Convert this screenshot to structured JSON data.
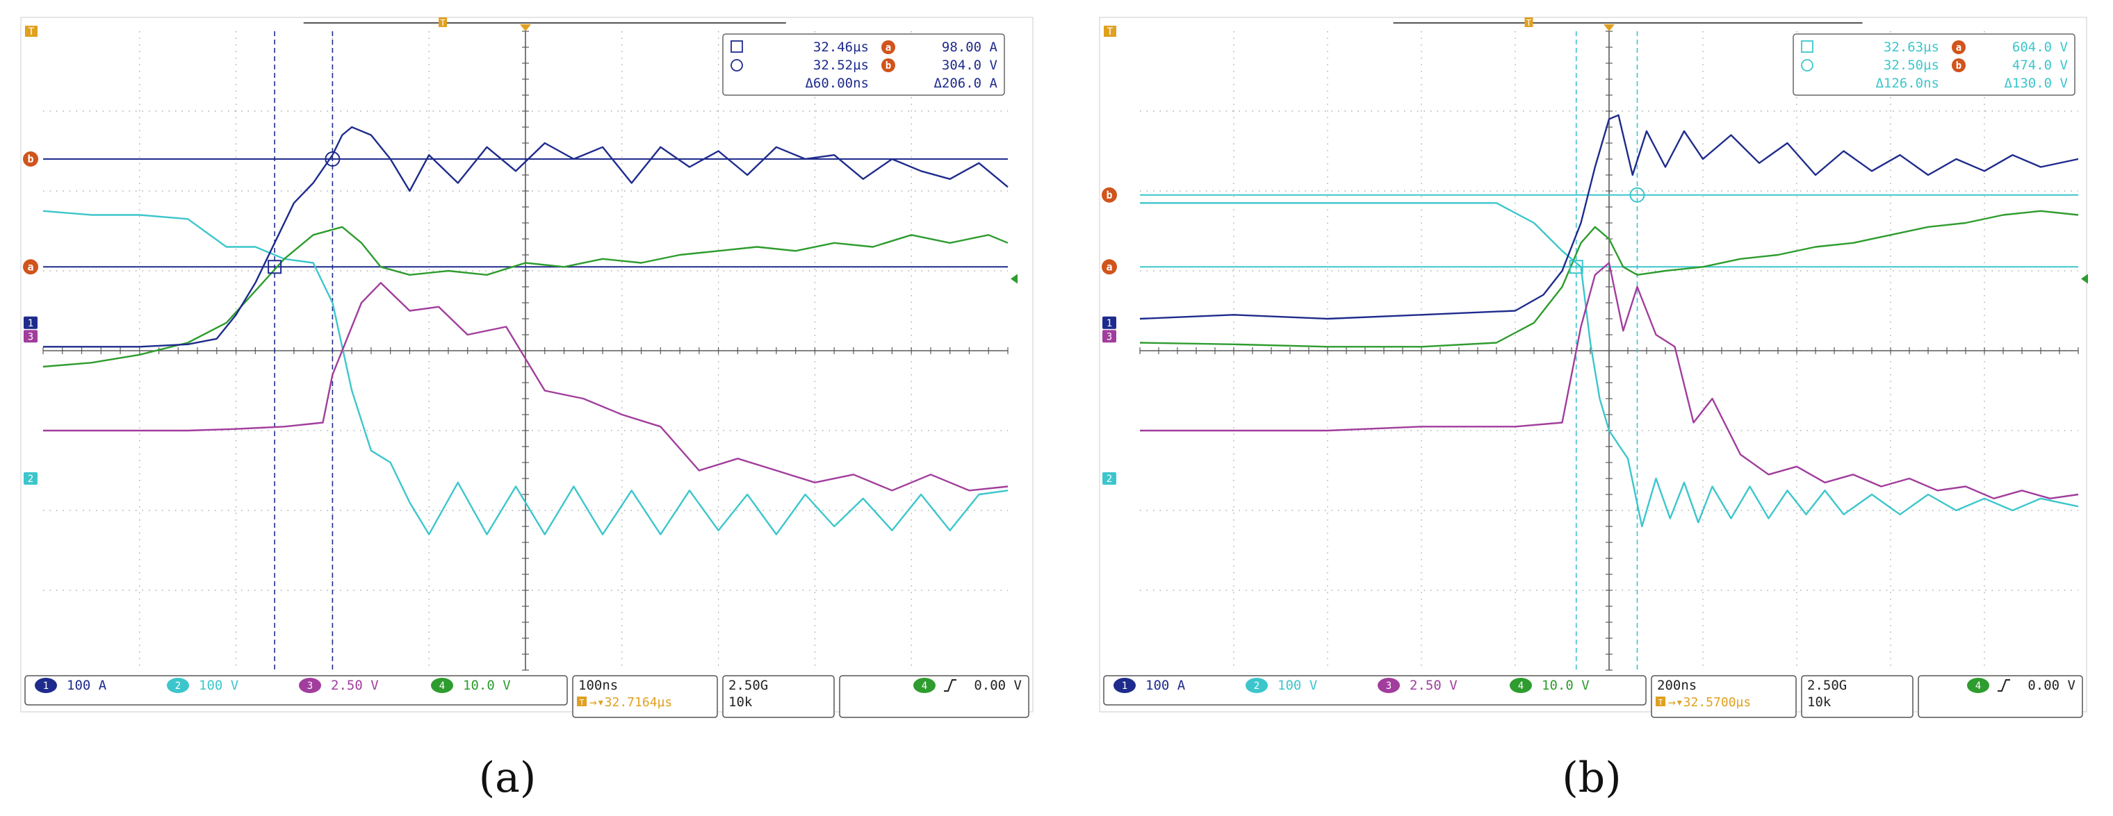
{
  "colors": {
    "ch1": "#1e2b8c",
    "ch2": "#3cc6cc",
    "ch3": "#a13d9c",
    "ch4": "#2e9c2e",
    "cursor_ab": "#d0541c",
    "trigger": "#e0a020",
    "grid": "#9a9a9a",
    "axis": "#5a5a5a",
    "frame": "#555555"
  },
  "chart_data": [
    {
      "type": "line",
      "sublabel": "(a)",
      "markers": {
        "trigger": "T",
        "cursor_a": "a",
        "cursor_b": "b",
        "ch1": "1",
        "ch2": "2",
        "ch3": "3",
        "ch4": "4"
      },
      "grid": {
        "divisions_x": 10,
        "divisions_y": 8
      },
      "readout": {
        "t1": "32.46µs",
        "t2": "32.52µs",
        "dt": "Δ60.00ns",
        "a_value": "98.00 A",
        "b_value": "304.0 V",
        "d_value": "Δ206.0 A"
      },
      "bottom_bar": {
        "ch1_scale": "100 A",
        "ch2_scale": "100 V",
        "ch3_scale": "2.50 V",
        "ch4_scale": "10.0 V",
        "timebase": "100ns",
        "trigger_pos": "32.7164µs",
        "sample_rate": "2.50G",
        "record_length": "10k",
        "trigger_source": "4",
        "trigger_level": "0.00 V"
      },
      "x_range_div": [
        0,
        10
      ],
      "y_range_div": [
        -4,
        4
      ],
      "ch1_level_div": 0.35,
      "ch2_level_div": -1.6,
      "ch3_level_div": 0.18,
      "cursor_time_div": [
        2.4,
        3.0
      ],
      "cursor_level_div": [
        1.05,
        2.4
      ],
      "series": [
        {
          "name": "1",
          "x": [
            0,
            0.5,
            1,
            1.5,
            1.8,
            2.0,
            2.2,
            2.4,
            2.6,
            2.8,
            3.0,
            3.1,
            3.2,
            3.4,
            3.6,
            3.8,
            4.0,
            4.3,
            4.6,
            4.9,
            5.2,
            5.5,
            5.8,
            6.1,
            6.4,
            6.7,
            7.0,
            7.3,
            7.6,
            7.9,
            8.2,
            8.5,
            8.8,
            9.1,
            9.4,
            9.7,
            10
          ],
          "y": [
            0.05,
            0.05,
            0.05,
            0.08,
            0.15,
            0.45,
            0.85,
            1.35,
            1.85,
            2.1,
            2.45,
            2.7,
            2.8,
            2.7,
            2.4,
            2.0,
            2.45,
            2.1,
            2.55,
            2.25,
            2.6,
            2.4,
            2.55,
            2.1,
            2.55,
            2.3,
            2.5,
            2.2,
            2.55,
            2.4,
            2.45,
            2.15,
            2.4,
            2.25,
            2.15,
            2.35,
            2.05
          ]
        },
        {
          "name": "2",
          "x": [
            0,
            0.5,
            1,
            1.5,
            1.9,
            2.2,
            2.5,
            2.8,
            3.0,
            3.2,
            3.4,
            3.6,
            3.8,
            4.0,
            4.3,
            4.6,
            4.9,
            5.2,
            5.5,
            5.8,
            6.1,
            6.4,
            6.7,
            7.0,
            7.3,
            7.6,
            7.9,
            8.2,
            8.5,
            8.8,
            9.1,
            9.4,
            9.7,
            10
          ],
          "y": [
            1.75,
            1.7,
            1.7,
            1.65,
            1.3,
            1.3,
            1.15,
            1.1,
            0.6,
            -0.5,
            -1.25,
            -1.4,
            -1.9,
            -2.3,
            -1.65,
            -2.3,
            -1.7,
            -2.3,
            -1.7,
            -2.3,
            -1.75,
            -2.3,
            -1.75,
            -2.25,
            -1.8,
            -2.3,
            -1.8,
            -2.2,
            -1.85,
            -2.25,
            -1.8,
            -2.25,
            -1.8,
            -1.75
          ]
        },
        {
          "name": "3",
          "x": [
            0,
            0.5,
            1,
            1.5,
            2.0,
            2.5,
            2.9,
            3.0,
            3.1,
            3.3,
            3.5,
            3.8,
            4.1,
            4.4,
            4.8,
            5.2,
            5.6,
            6.0,
            6.4,
            6.8,
            7.2,
            7.6,
            8.0,
            8.4,
            8.8,
            9.2,
            9.6,
            10
          ],
          "y": [
            -1.0,
            -1.0,
            -1.0,
            -1.0,
            -0.98,
            -0.95,
            -0.9,
            -0.3,
            0.0,
            0.6,
            0.85,
            0.5,
            0.55,
            0.2,
            0.3,
            -0.5,
            -0.6,
            -0.8,
            -0.95,
            -1.5,
            -1.35,
            -1.5,
            -1.65,
            -1.55,
            -1.75,
            -1.55,
            -1.75,
            -1.7
          ]
        },
        {
          "name": "4",
          "x": [
            0,
            0.5,
            1,
            1.5,
            1.9,
            2.2,
            2.5,
            2.8,
            3.1,
            3.3,
            3.5,
            3.8,
            4.2,
            4.6,
            5.0,
            5.4,
            5.8,
            6.2,
            6.6,
            7.0,
            7.4,
            7.8,
            8.2,
            8.6,
            9.0,
            9.4,
            9.8,
            10
          ],
          "y": [
            -0.2,
            -0.15,
            -0.05,
            0.1,
            0.35,
            0.75,
            1.15,
            1.45,
            1.55,
            1.35,
            1.05,
            0.95,
            1.0,
            0.95,
            1.1,
            1.05,
            1.15,
            1.1,
            1.2,
            1.25,
            1.3,
            1.25,
            1.35,
            1.3,
            1.45,
            1.35,
            1.45,
            1.35
          ]
        }
      ]
    },
    {
      "type": "line",
      "sublabel": "(b)",
      "markers": {
        "trigger": "T",
        "cursor_a": "a",
        "cursor_b": "b",
        "ch1": "1",
        "ch2": "2",
        "ch3": "3",
        "ch4": "4"
      },
      "grid": {
        "divisions_x": 10,
        "divisions_y": 8
      },
      "readout": {
        "t1": "32.63µs",
        "t2": "32.50µs",
        "dt": "Δ126.0ns",
        "a_value": "604.0 V",
        "b_value": "474.0 V",
        "d_value": "Δ130.0 V"
      },
      "bottom_bar": {
        "ch1_scale": "100 A",
        "ch2_scale": "100 V",
        "ch3_scale": "2.50 V",
        "ch4_scale": "10.0 V",
        "timebase": "200ns",
        "trigger_pos": "32.5700µs",
        "sample_rate": "2.50G",
        "record_length": "10k",
        "trigger_source": "4",
        "trigger_level": "0.00 V"
      },
      "x_range_div": [
        0,
        10
      ],
      "y_range_div": [
        -4,
        4
      ],
      "ch1_level_div": 0.35,
      "ch2_level_div": -1.6,
      "ch3_level_div": 0.18,
      "cursor_time_div": [
        4.65,
        5.3
      ],
      "cursor_level_div": [
        1.05,
        1.95
      ],
      "series": [
        {
          "name": "1",
          "x": [
            0,
            1,
            2,
            3,
            4,
            4.3,
            4.5,
            4.7,
            4.85,
            5.0,
            5.1,
            5.25,
            5.4,
            5.6,
            5.8,
            6.0,
            6.3,
            6.6,
            6.9,
            7.2,
            7.5,
            7.8,
            8.1,
            8.4,
            8.7,
            9.0,
            9.3,
            9.6,
            10
          ],
          "y": [
            0.4,
            0.45,
            0.4,
            0.45,
            0.5,
            0.7,
            1.0,
            1.6,
            2.3,
            2.9,
            2.95,
            2.2,
            2.75,
            2.3,
            2.75,
            2.4,
            2.7,
            2.35,
            2.6,
            2.2,
            2.5,
            2.25,
            2.45,
            2.2,
            2.4,
            2.25,
            2.45,
            2.3,
            2.4
          ]
        },
        {
          "name": "2",
          "x": [
            0,
            1,
            2,
            3,
            3.8,
            4.2,
            4.5,
            4.7,
            4.8,
            4.9,
            5.0,
            5.2,
            5.35,
            5.5,
            5.65,
            5.8,
            5.95,
            6.1,
            6.3,
            6.5,
            6.7,
            6.9,
            7.1,
            7.3,
            7.5,
            7.8,
            8.1,
            8.4,
            8.7,
            9.0,
            9.3,
            9.6,
            10
          ],
          "y": [
            1.85,
            1.85,
            1.85,
            1.85,
            1.85,
            1.6,
            1.25,
            1.05,
            0.1,
            -0.6,
            -1.0,
            -1.35,
            -2.2,
            -1.6,
            -2.1,
            -1.65,
            -2.15,
            -1.7,
            -2.1,
            -1.7,
            -2.1,
            -1.75,
            -2.05,
            -1.75,
            -2.05,
            -1.8,
            -2.05,
            -1.8,
            -2.0,
            -1.85,
            -2.0,
            -1.85,
            -1.95
          ]
        },
        {
          "name": "3",
          "x": [
            0,
            1,
            2,
            3,
            4,
            4.5,
            4.7,
            4.85,
            5.0,
            5.15,
            5.3,
            5.5,
            5.7,
            5.9,
            6.1,
            6.4,
            6.7,
            7.0,
            7.3,
            7.6,
            7.9,
            8.2,
            8.5,
            8.8,
            9.1,
            9.4,
            9.7,
            10
          ],
          "y": [
            -1.0,
            -1.0,
            -1.0,
            -0.95,
            -0.95,
            -0.9,
            0.3,
            0.95,
            1.1,
            0.25,
            0.8,
            0.2,
            0.05,
            -0.9,
            -0.6,
            -1.3,
            -1.55,
            -1.45,
            -1.65,
            -1.55,
            -1.7,
            -1.6,
            -1.75,
            -1.7,
            -1.85,
            -1.75,
            -1.85,
            -1.8
          ]
        },
        {
          "name": "4",
          "x": [
            0,
            1,
            2,
            3,
            3.8,
            4.2,
            4.5,
            4.7,
            4.85,
            5.0,
            5.15,
            5.3,
            5.6,
            6.0,
            6.4,
            6.8,
            7.2,
            7.6,
            8.0,
            8.4,
            8.8,
            9.2,
            9.6,
            10
          ],
          "y": [
            0.1,
            0.08,
            0.05,
            0.05,
            0.1,
            0.35,
            0.8,
            1.35,
            1.55,
            1.4,
            1.05,
            0.95,
            1.0,
            1.05,
            1.15,
            1.2,
            1.3,
            1.35,
            1.45,
            1.55,
            1.6,
            1.7,
            1.75,
            1.7
          ]
        }
      ]
    }
  ]
}
